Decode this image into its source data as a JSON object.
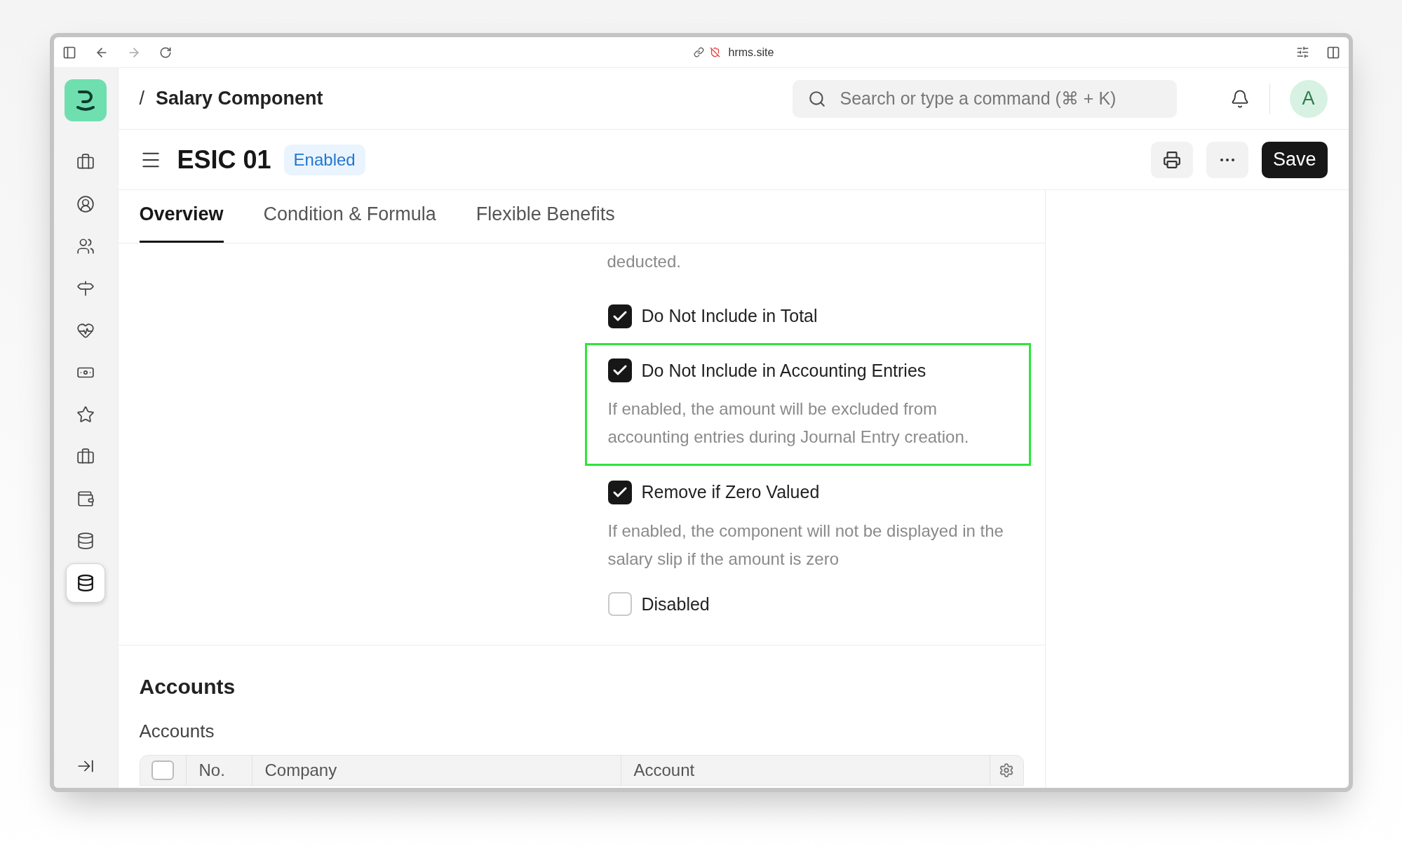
{
  "browser": {
    "url": "hrms.site"
  },
  "topbar": {
    "separator": "/",
    "breadcrumb": "Salary Component",
    "search": {
      "placeholder": "Search or type a command (⌘ + K)"
    },
    "avatar": "A"
  },
  "sidebar": {
    "items": [
      {
        "selected": false
      },
      {
        "selected": false
      },
      {
        "selected": false
      },
      {
        "selected": false
      },
      {
        "selected": false
      },
      {
        "selected": false
      },
      {
        "selected": false
      },
      {
        "selected": false
      },
      {
        "selected": false
      },
      {
        "selected": false
      },
      {
        "selected": true
      }
    ]
  },
  "document": {
    "title": "ESIC 01",
    "status": "Enabled",
    "save": "Save"
  },
  "tabs": [
    {
      "label": "Overview",
      "selected": true
    },
    {
      "label": "Condition & Formula",
      "selected": false
    },
    {
      "label": "Flexible Benefits",
      "selected": false
    }
  ],
  "form": {
    "description_tail": "deducted.",
    "fields": [
      {
        "label": "Do Not Include in Total",
        "checked": true,
        "highlighted": false
      },
      {
        "label": "Do Not Include in Accounting Entries",
        "checked": true,
        "highlighted": true,
        "description": "If enabled, the amount will be excluded from accounting entries during Journal Entry creation."
      },
      {
        "label": "Remove if Zero Valued",
        "checked": true,
        "highlighted": false,
        "description": "If enabled, the component will not be displayed in the salary slip if the amount is zero"
      },
      {
        "label": "Disabled",
        "checked": false,
        "highlighted": false
      }
    ]
  },
  "accounts": {
    "heading": "Accounts",
    "label": "Accounts",
    "table": {
      "select_all_checked": false,
      "columns": [
        "No.",
        "Company",
        "Account"
      ]
    }
  }
}
